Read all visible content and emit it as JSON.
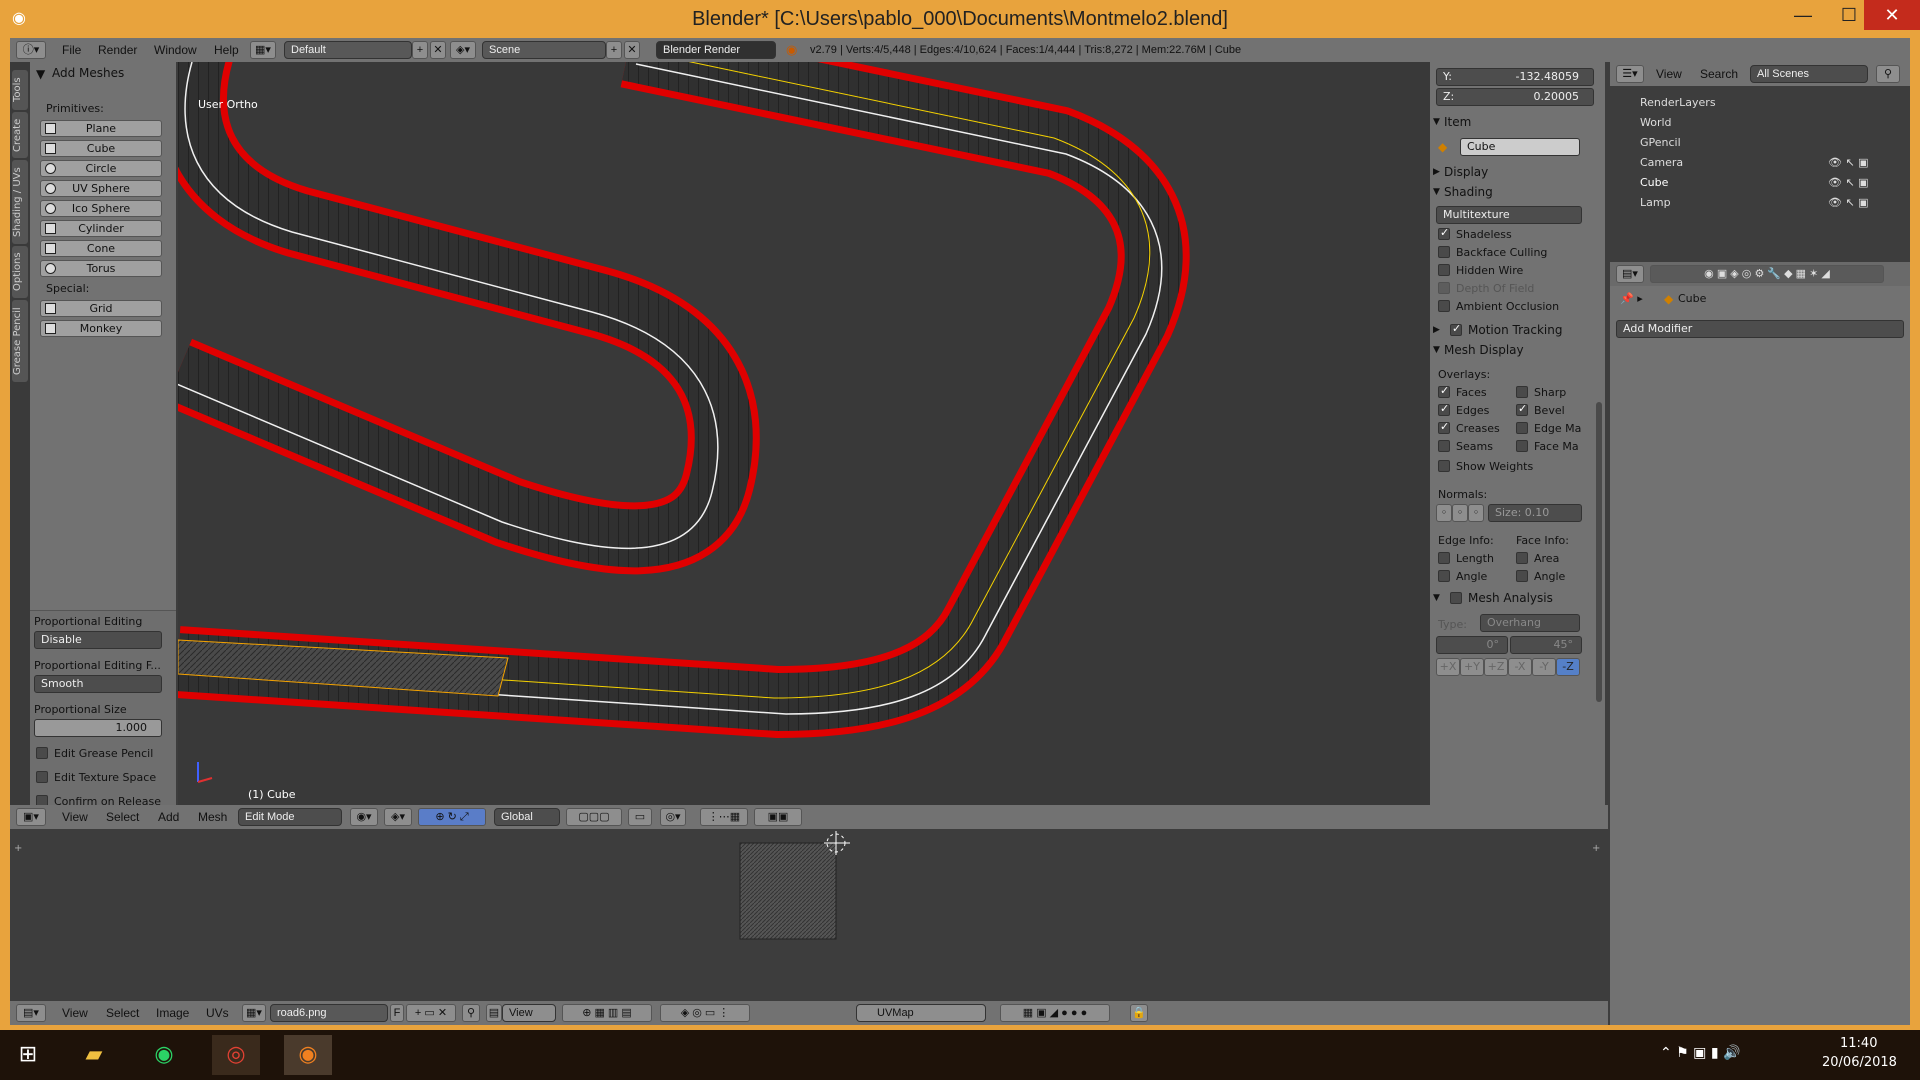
{
  "window": {
    "title": "Blender* [C:\\Users\\pablo_000\\Documents\\Montmelo2.blend]"
  },
  "top_header": {
    "menus": [
      "File",
      "Render",
      "Window",
      "Help"
    ],
    "layout": "Default",
    "scene": "Scene",
    "engine": "Blender Render",
    "stats": "v2.79 | Verts:4/5,448 | Edges:4/10,624 | Faces:1/4,444 | Tris:8,272 | Mem:22.76M | Cube"
  },
  "tool_tabs": [
    "Tools",
    "Create",
    "Shading / UVs",
    "Options",
    "Grease Pencil"
  ],
  "tool_shelf": {
    "panel_title": "Add Meshes",
    "primitives_label": "Primitives:",
    "primitives": [
      "Plane",
      "Cube",
      "Circle",
      "UV Sphere",
      "Ico Sphere",
      "Cylinder",
      "Cone",
      "Torus"
    ],
    "special_label": "Special:",
    "special": [
      "Grid",
      "Monkey"
    ],
    "prop_editing_label": "Proportional Editing",
    "prop_editing_value": "Disable",
    "prop_falloff_label": "Proportional Editing F...",
    "prop_falloff_value": "Smooth",
    "prop_size_label": "Proportional Size",
    "prop_size_value": "1.000",
    "options": [
      {
        "label": "Edit Grease Pencil",
        "checked": false
      },
      {
        "label": "Edit Texture Space",
        "checked": false
      },
      {
        "label": "Confirm on Release",
        "checked": false
      }
    ]
  },
  "viewport": {
    "view_label": "User Ortho",
    "object_label": "(1) Cube"
  },
  "viewport_header": {
    "menus": [
      "View",
      "Select",
      "Add",
      "Mesh"
    ],
    "mode": "Edit Mode",
    "orientation": "Global"
  },
  "npanel": {
    "y_label": "Y:",
    "y_value": "-132.48059",
    "z_label": "Z:",
    "z_value": "0.20005",
    "item_title": "Item",
    "item_name": "Cube",
    "display_title": "Display",
    "shading_title": "Shading",
    "shading_mode": "Multitexture",
    "shading_opts": [
      {
        "label": "Shadeless",
        "checked": true,
        "enabled": true
      },
      {
        "label": "Backface Culling",
        "checked": false,
        "enabled": true
      },
      {
        "label": "Hidden Wire",
        "checked": false,
        "enabled": true
      },
      {
        "label": "Depth Of Field",
        "checked": false,
        "enabled": false
      },
      {
        "label": "Ambient Occlusion",
        "checked": false,
        "enabled": true
      }
    ],
    "motion_tracking_title": "Motion Tracking",
    "mesh_display_title": "Mesh Display",
    "overlays_label": "Overlays:",
    "overlays_left": [
      {
        "label": "Faces",
        "checked": true
      },
      {
        "label": "Edges",
        "checked": true
      },
      {
        "label": "Creases",
        "checked": true
      },
      {
        "label": "Seams",
        "checked": false
      }
    ],
    "overlays_right": [
      {
        "label": "Sharp",
        "checked": false
      },
      {
        "label": "Bevel",
        "checked": true
      },
      {
        "label": "Edge Ma",
        "checked": false
      },
      {
        "label": "Face Ma",
        "checked": false
      }
    ],
    "show_weights": "Show Weights",
    "normals_label": "Normals:",
    "normals_size": "Size:  0.10",
    "edge_info_label": "Edge Info:",
    "face_info_label": "Face Info:",
    "edge_info": [
      "Length",
      "Angle"
    ],
    "face_info": [
      "Area",
      "Angle"
    ],
    "mesh_analysis_title": "Mesh Analysis",
    "type_label": "Type:",
    "type_value": "Overhang",
    "angle_min": "0°",
    "angle_max": "45°",
    "axes": [
      "+X",
      "+Y",
      "+Z",
      "-X",
      "-Y",
      "-Z"
    ]
  },
  "outliner": {
    "menus": [
      "View",
      "Search"
    ],
    "filter": "All Scenes",
    "items": [
      "RenderLayers",
      "World",
      "GPencil",
      "Camera",
      "Cube",
      "Lamp"
    ]
  },
  "properties": {
    "object": "Cube",
    "add_modifier": "Add Modifier"
  },
  "uv_header": {
    "menus": [
      "View",
      "Select",
      "Image",
      "UVs"
    ],
    "image": "road6.png",
    "f_label": "F",
    "view": "View",
    "uvmap": "UVMap"
  },
  "taskbar": {
    "time": "11:40",
    "date": "20/06/2018"
  },
  "colors": {
    "accent_orange": "#e8a33d",
    "edge_red": "#e00000",
    "viewport_bg": "#393939",
    "panel_gray": "#727272"
  }
}
